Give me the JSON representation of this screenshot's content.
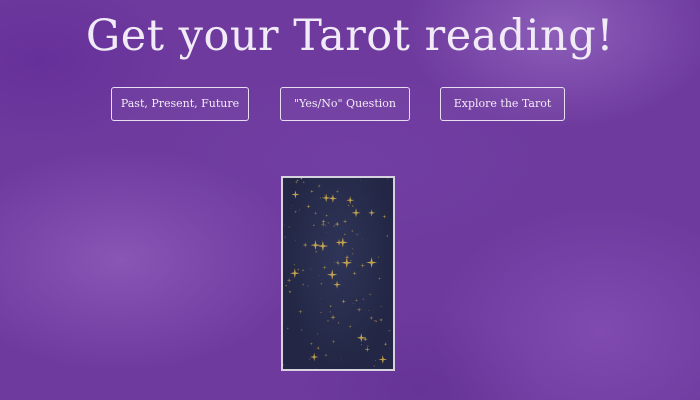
{
  "page": {
    "title": "Get your Tarot reading!"
  },
  "nav": {
    "buttons": [
      {
        "label": "Past, Present, Future"
      },
      {
        "label": "\"Yes/No\" Question"
      },
      {
        "label": "Explore the Tarot"
      }
    ]
  },
  "card": {
    "face": "back",
    "pattern": "gold-stars",
    "colors": {
      "background": "#262a48",
      "star": "#c9a94e",
      "border": "#d7d3de"
    }
  },
  "colors": {
    "background": "#6e3a9e",
    "text": "#f1eaf7"
  }
}
